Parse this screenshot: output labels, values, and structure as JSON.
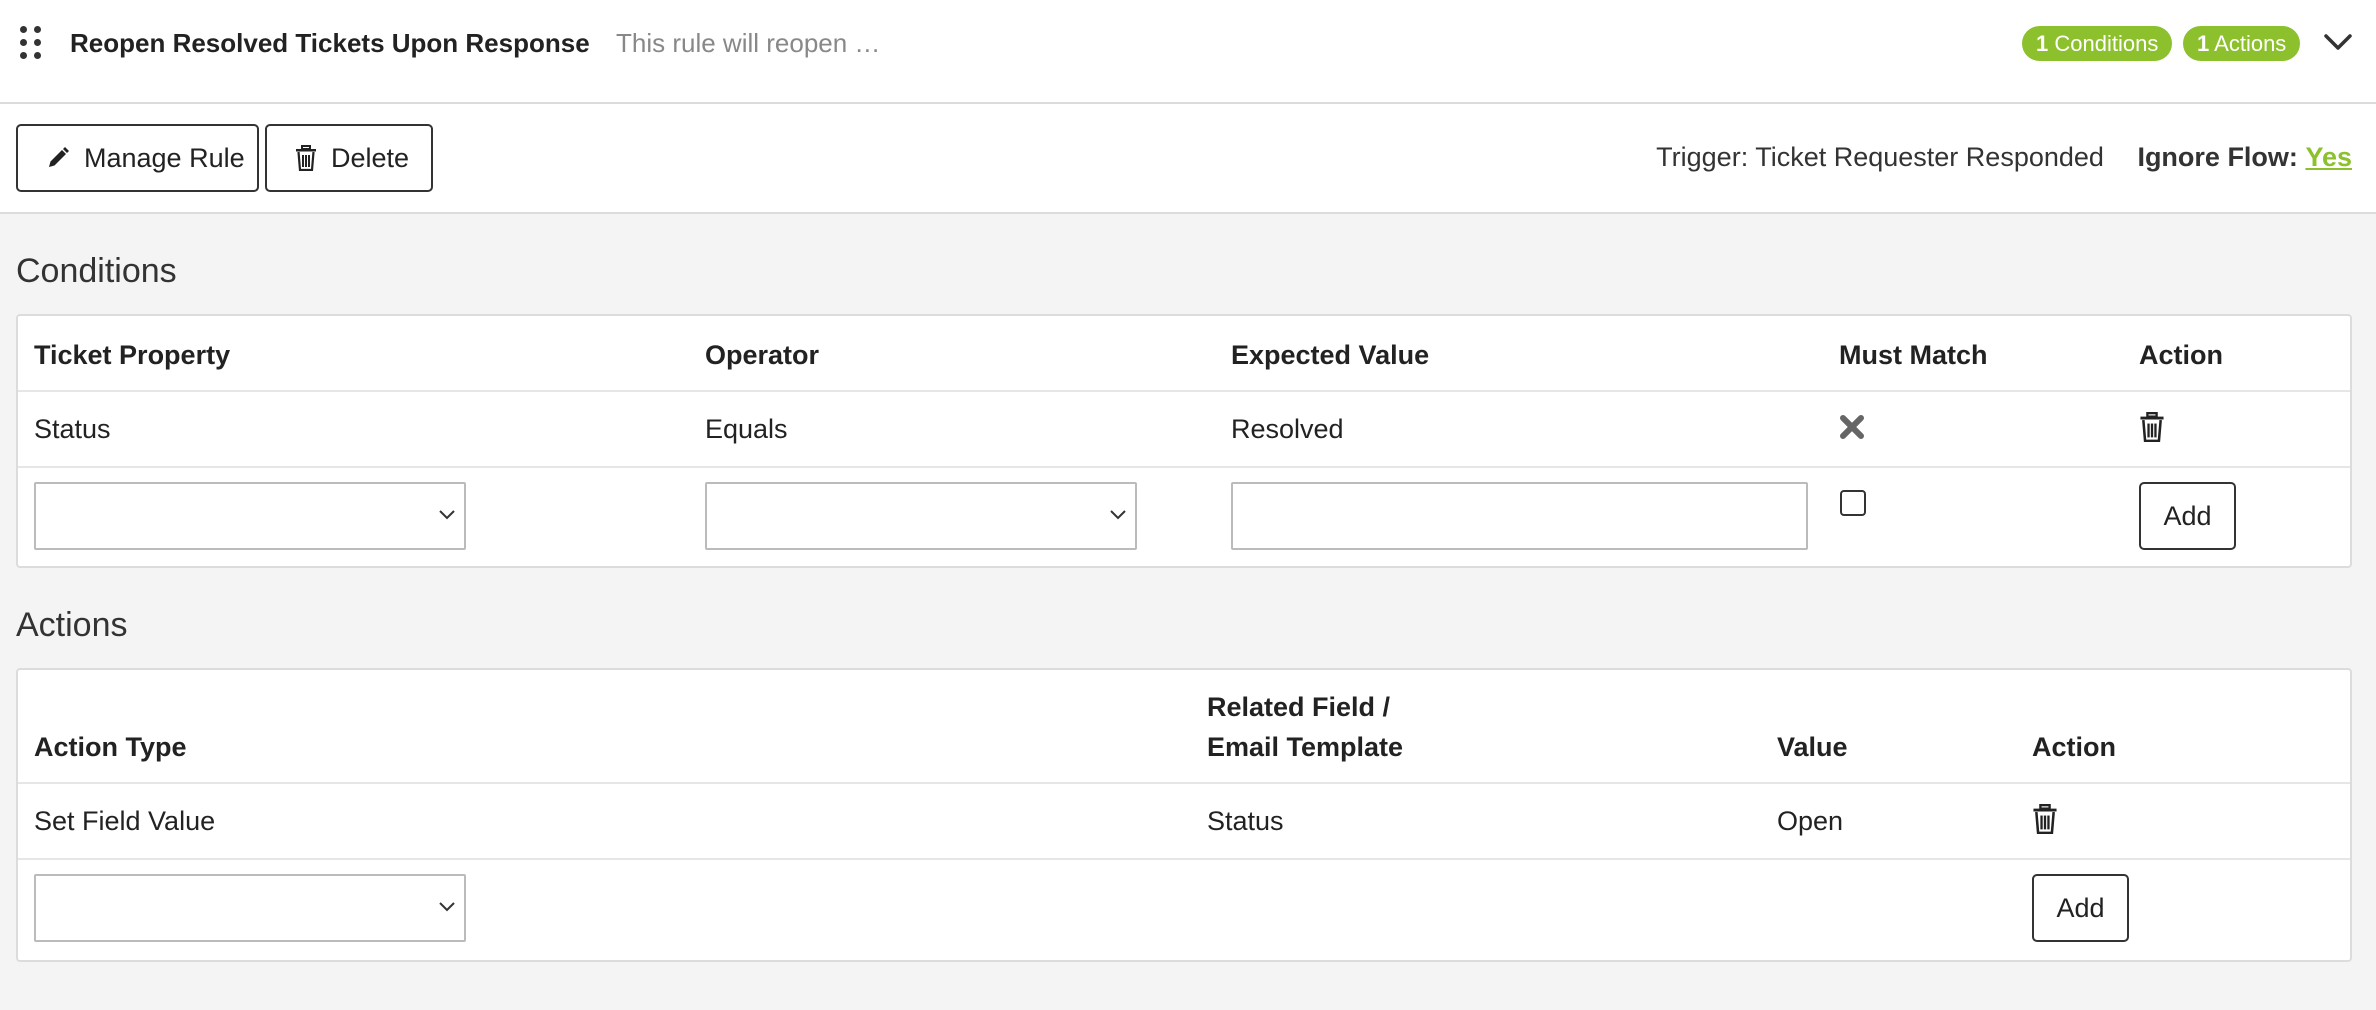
{
  "header": {
    "title": "Reopen Resolved Tickets Upon Response",
    "description": "This rule will reopen …",
    "conditions_badge": {
      "count": "1",
      "label": "Conditions"
    },
    "actions_badge": {
      "count": "1",
      "label": "Actions"
    },
    "accent_color": "#8cc02c",
    "collapse_icon": "chevron-down-icon"
  },
  "toolbar": {
    "manage_label": "Manage Rule",
    "manage_icon": "pencil-icon",
    "delete_label": "Delete",
    "delete_icon": "trash-icon",
    "trigger_label": "Trigger:",
    "trigger_value": "Ticket Requester Responded",
    "ignore_flow_label": "Ignore Flow:",
    "ignore_flow_value": "Yes"
  },
  "conditions": {
    "title": "Conditions",
    "columns": [
      "Ticket Property",
      "Operator",
      "Expected Value",
      "Must Match",
      "Action"
    ],
    "rows": [
      {
        "property": "Status",
        "operator": "Equals",
        "expected": "Resolved",
        "must_match_icon": "x-mark-icon",
        "action_icon": "trash-icon"
      }
    ],
    "new_row": {
      "property_value": "",
      "operator_value": "",
      "expected_value": "",
      "must_match_checked": false,
      "add_label": "Add"
    }
  },
  "actions": {
    "title": "Actions",
    "columns": [
      "Action Type",
      "Related Field /",
      "Email Template",
      "Value",
      "Action"
    ],
    "rows": [
      {
        "type": "Set Field Value",
        "related": "Status",
        "value": "Open",
        "action_icon": "trash-icon"
      }
    ],
    "new_row": {
      "type_value": "",
      "add_label": "Add"
    }
  }
}
